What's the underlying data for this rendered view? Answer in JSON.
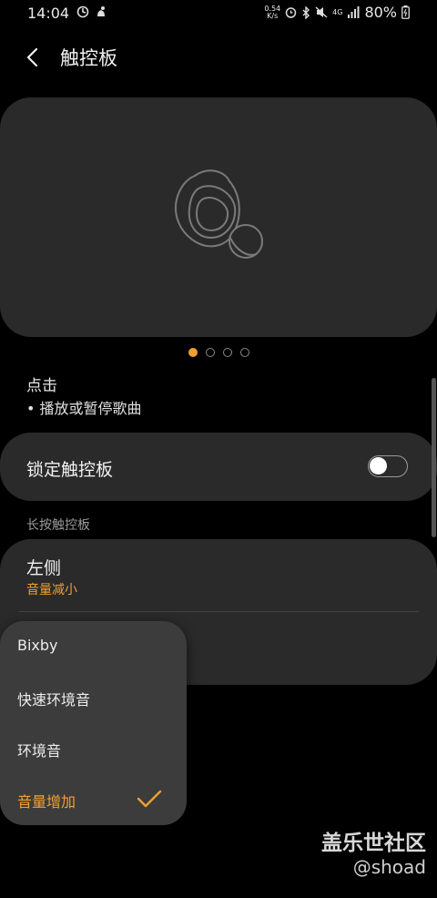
{
  "status_bar": {
    "time": "14:04",
    "speed_value": "0.54",
    "speed_unit": "K/s",
    "network": "4G",
    "battery_percent": "80%",
    "icons": [
      "sync-icon",
      "notification-icon",
      "alarm-icon",
      "bluetooth-icon",
      "mute-icon",
      "signal-icon",
      "battery-icon"
    ]
  },
  "header": {
    "title": "触控板"
  },
  "pager": {
    "count": 4,
    "active_index": 0
  },
  "tap": {
    "title": "点击",
    "description": "• 播放或暂停歌曲"
  },
  "lock_touchpad": {
    "label": "锁定触控板",
    "enabled": false
  },
  "long_press": {
    "section_title": "长按触控板",
    "left": {
      "title": "左侧",
      "value": "音量减小"
    }
  },
  "popup_menu": {
    "items": [
      {
        "label": "Bixby",
        "selected": false
      },
      {
        "label": "快速环境音",
        "selected": false
      },
      {
        "label": "环境音",
        "selected": false
      },
      {
        "label": "音量增加",
        "selected": true
      }
    ]
  },
  "colors": {
    "accent": "#f0a030",
    "card": "#2a2a2a",
    "background": "#000000",
    "popup": "#3c3c3c"
  },
  "watermark": {
    "brand": "盖乐世社区",
    "user": "@shoad"
  }
}
